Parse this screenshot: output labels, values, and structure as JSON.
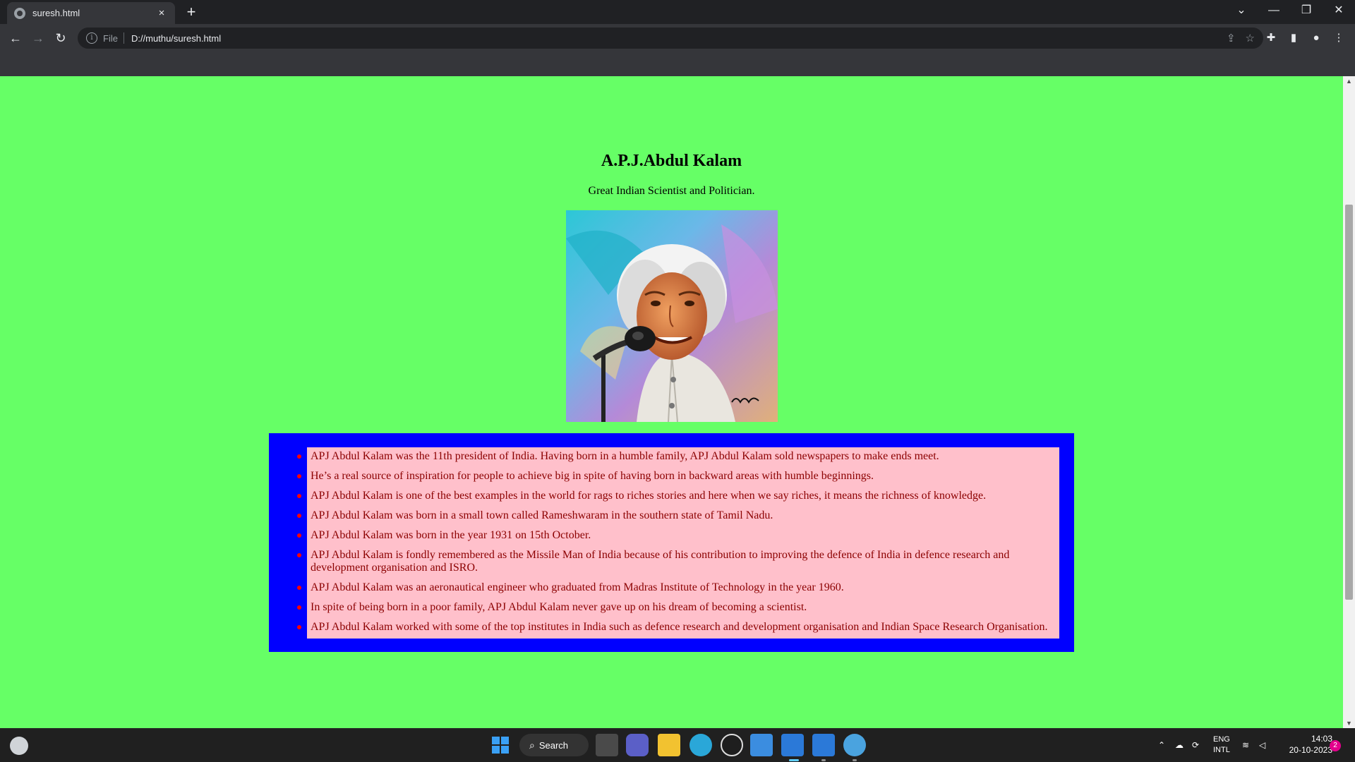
{
  "browser": {
    "tab_title": "suresh.html",
    "tab_close": "×",
    "new_tab": "+",
    "address": {
      "scheme_label": "File",
      "url": "D://muthu/suresh.html"
    }
  },
  "page": {
    "heading": "A.P.J.Abdul Kalam",
    "subtitle": "Great Indian Scientist and Politician.",
    "facts": [
      "APJ Abdul Kalam was the 11th president of India. Having born in a humble family, APJ Abdul Kalam sold newspapers to make ends meet.",
      "He’s a real source of inspiration for people to achieve big in spite of having born in backward areas with humble beginnings.",
      "APJ Abdul Kalam is one of the best examples in the world for rags to riches stories and here when we say riches, it means the richness of knowledge.",
      "APJ Abdul Kalam was born in a small town called Rameshwaram in the southern state of Tamil Nadu.",
      "APJ Abdul Kalam was born in the year 1931 on 15th October.",
      "APJ Abdul Kalam is fondly remembered as the Missile Man of India because of his contribution to improving the defence of India in defence research and development organisation and ISRO.",
      "APJ Abdul Kalam was an aeronautical engineer who graduated from Madras Institute of Technology in the year 1960.",
      "In spite of being born in a poor family, APJ Abdul Kalam never gave up on his dream of becoming a scientist.",
      "APJ Abdul Kalam worked with some of the top institutes in India such as defence research and development organisation and Indian Space Research Organisation."
    ],
    "colors": {
      "background": "#66ff66",
      "box": "#0000ff",
      "list": "#ffc0cb",
      "text": "#8b0000",
      "bullet": "#ff0000"
    }
  },
  "taskbar": {
    "search_label": "Search",
    "lang_line1": "ENG",
    "lang_line2": "INTL",
    "time": "14:03",
    "date": "20-10-2023",
    "notifications": "2"
  }
}
